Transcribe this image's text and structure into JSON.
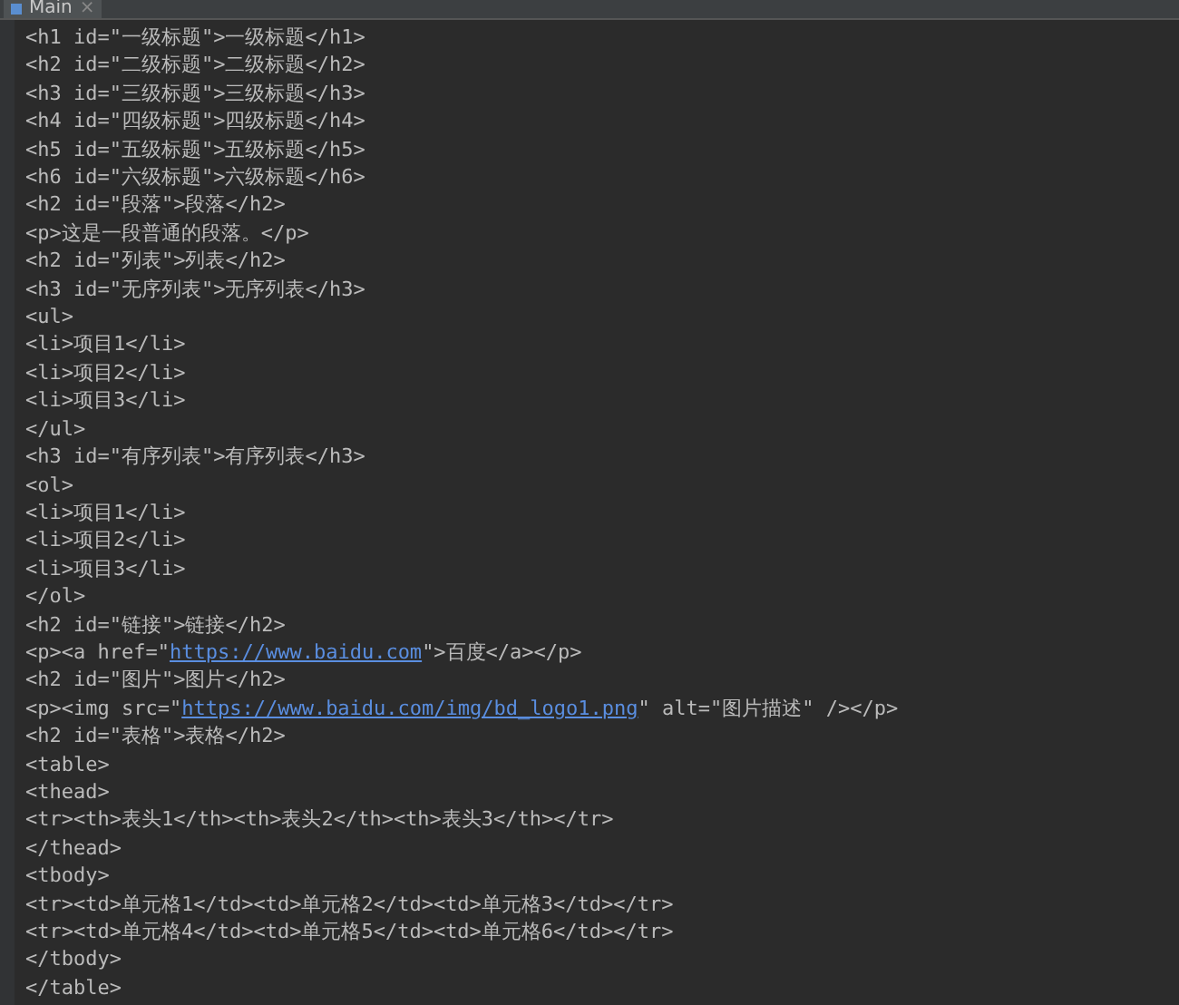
{
  "tab": {
    "label": "Main",
    "close": "×",
    "selected": true
  },
  "lines": [
    [
      {
        "kind": "text",
        "text": "<h1 id=\"一级标题\">一级标题</h1>"
      }
    ],
    [
      {
        "kind": "text",
        "text": "<h2 id=\"二级标题\">二级标题</h2>"
      }
    ],
    [
      {
        "kind": "text",
        "text": "<h3 id=\"三级标题\">三级标题</h3>"
      }
    ],
    [
      {
        "kind": "text",
        "text": "<h4 id=\"四级标题\">四级标题</h4>"
      }
    ],
    [
      {
        "kind": "text",
        "text": "<h5 id=\"五级标题\">五级标题</h5>"
      }
    ],
    [
      {
        "kind": "text",
        "text": "<h6 id=\"六级标题\">六级标题</h6>"
      }
    ],
    [
      {
        "kind": "text",
        "text": "<h2 id=\"段落\">段落</h2>"
      }
    ],
    [
      {
        "kind": "text",
        "text": "<p>这是一段普通的段落。</p>"
      }
    ],
    [
      {
        "kind": "text",
        "text": "<h2 id=\"列表\">列表</h2>"
      }
    ],
    [
      {
        "kind": "text",
        "text": "<h3 id=\"无序列表\">无序列表</h3>"
      }
    ],
    [
      {
        "kind": "text",
        "text": "<ul>"
      }
    ],
    [
      {
        "kind": "text",
        "text": "<li>项目1</li>"
      }
    ],
    [
      {
        "kind": "text",
        "text": "<li>项目2</li>"
      }
    ],
    [
      {
        "kind": "text",
        "text": "<li>项目3</li>"
      }
    ],
    [
      {
        "kind": "text",
        "text": "</ul>"
      }
    ],
    [
      {
        "kind": "text",
        "text": "<h3 id=\"有序列表\">有序列表</h3>"
      }
    ],
    [
      {
        "kind": "text",
        "text": "<ol>"
      }
    ],
    [
      {
        "kind": "text",
        "text": "<li>项目1</li>"
      }
    ],
    [
      {
        "kind": "text",
        "text": "<li>项目2</li>"
      }
    ],
    [
      {
        "kind": "text",
        "text": "<li>项目3</li>"
      }
    ],
    [
      {
        "kind": "text",
        "text": "</ol>"
      }
    ],
    [
      {
        "kind": "text",
        "text": "<h2 id=\"链接\">链接</h2>"
      }
    ],
    [
      {
        "kind": "text",
        "text": "<p><a href=\""
      },
      {
        "kind": "link",
        "text": "https://www.baidu.com"
      },
      {
        "kind": "text",
        "text": "\">百度</a></p>"
      }
    ],
    [
      {
        "kind": "text",
        "text": "<h2 id=\"图片\">图片</h2>"
      }
    ],
    [
      {
        "kind": "text",
        "text": "<p><img src=\""
      },
      {
        "kind": "link",
        "text": "https://www.baidu.com/img/bd_logo1.png"
      },
      {
        "kind": "text",
        "text": "\" alt=\"图片描述\" /></p>"
      }
    ],
    [
      {
        "kind": "text",
        "text": "<h2 id=\"表格\">表格</h2>"
      }
    ],
    [
      {
        "kind": "text",
        "text": "<table>"
      }
    ],
    [
      {
        "kind": "text",
        "text": "<thead>"
      }
    ],
    [
      {
        "kind": "text",
        "text": "<tr><th>表头1</th><th>表头2</th><th>表头3</th></tr>"
      }
    ],
    [
      {
        "kind": "text",
        "text": "</thead>"
      }
    ],
    [
      {
        "kind": "text",
        "text": "<tbody>"
      }
    ],
    [
      {
        "kind": "text",
        "text": "<tr><td>单元格1</td><td>单元格2</td><td>单元格3</td></tr>"
      }
    ],
    [
      {
        "kind": "text",
        "text": "<tr><td>单元格4</td><td>单元格5</td><td>单元格6</td></tr>"
      }
    ],
    [
      {
        "kind": "text",
        "text": "</tbody>"
      }
    ],
    [
      {
        "kind": "text",
        "text": "</table>"
      }
    ]
  ]
}
